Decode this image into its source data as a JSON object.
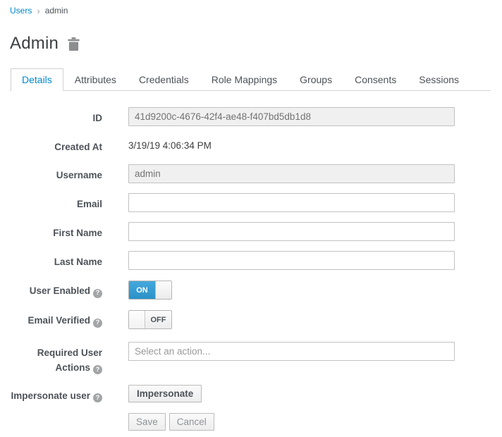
{
  "colors": {
    "accent_blue": "#0088ce",
    "toggle_on_blue": "#39a5dc",
    "text_dark": "#4d5258",
    "muted_gray": "#8f9296"
  },
  "icons": {
    "breadcrumb_separator": "›",
    "help": "?"
  },
  "breadcrumb": {
    "users": "Users",
    "current": "admin"
  },
  "header": {
    "title": "Admin"
  },
  "tabs": {
    "active": "Details",
    "items": [
      "Details",
      "Attributes",
      "Credentials",
      "Role Mappings",
      "Groups",
      "Consents",
      "Sessions"
    ]
  },
  "form": {
    "id": {
      "label": "ID",
      "value": "41d9200c-4676-42f4-ae48-f407bd5db1d8"
    },
    "created_at": {
      "label": "Created At",
      "value": "3/19/19 4:06:34 PM"
    },
    "username": {
      "label": "Username",
      "value": "admin"
    },
    "email": {
      "label": "Email",
      "value": ""
    },
    "first_name": {
      "label": "First Name",
      "value": ""
    },
    "last_name": {
      "label": "Last Name",
      "value": ""
    },
    "user_enabled": {
      "label": "User Enabled",
      "state": "ON"
    },
    "email_verified": {
      "label": "Email Verified",
      "state": "OFF"
    },
    "required_actions": {
      "label": "Required User Actions",
      "placeholder": "Select an action..."
    },
    "impersonate": {
      "label": "Impersonate user",
      "button": "Impersonate"
    },
    "actions": {
      "save": "Save",
      "cancel": "Cancel"
    }
  }
}
